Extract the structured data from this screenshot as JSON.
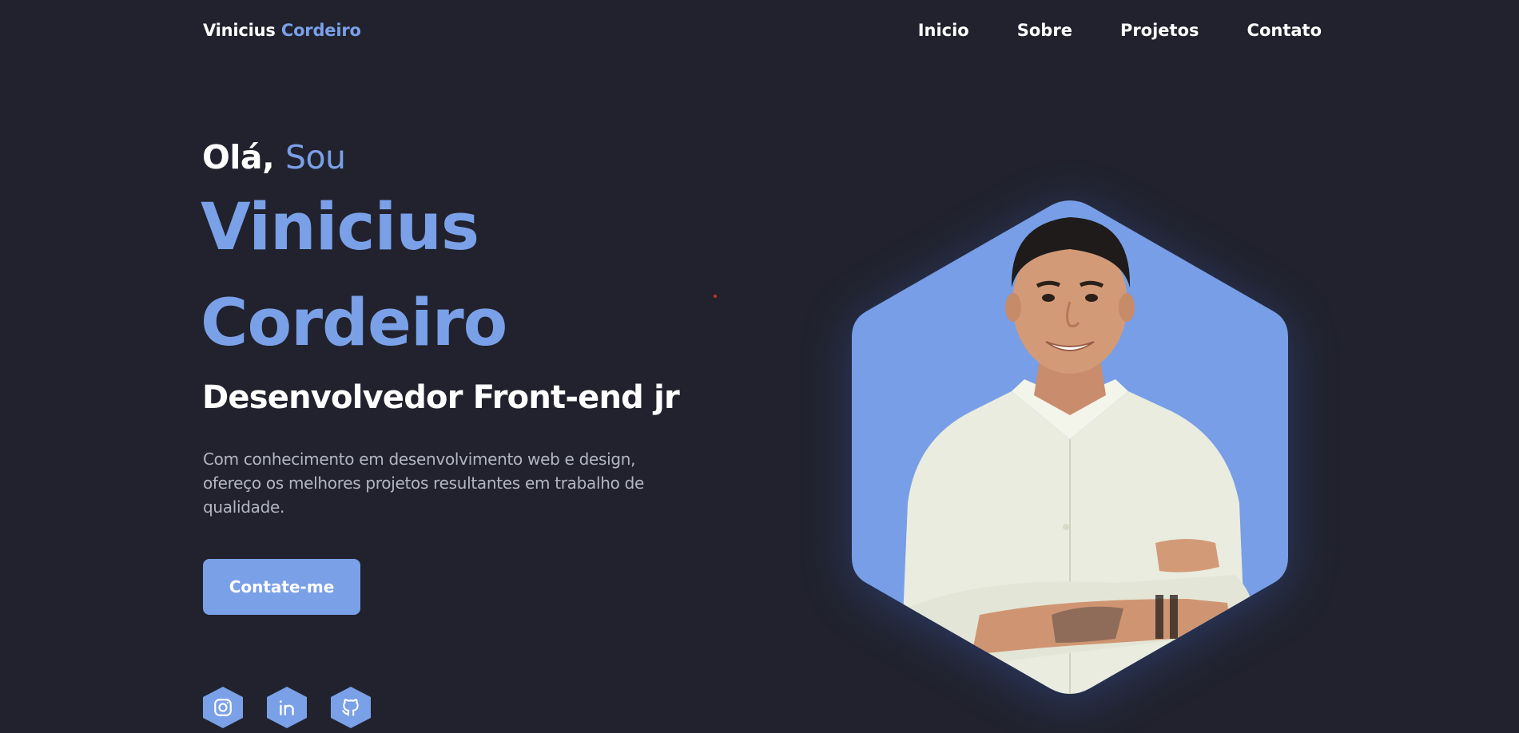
{
  "header": {
    "logo_first": "Vinicius",
    "logo_second": "Cordeiro",
    "nav": [
      "Inicio",
      "Sobre",
      "Projetos",
      "Contato"
    ]
  },
  "hero": {
    "greeting_prefix": "Olá,",
    "greeting_accent": "Sou",
    "first_name": "Vinicius",
    "last_name": "Cordeiro",
    "role": "Desenvolvedor Front-end jr",
    "description": "Com conhecimento em desenvolvimento web e design, ofereço os melhores projetos resultantes em trabalho de qualidade.",
    "cta_label": "Contate-me"
  },
  "social": [
    {
      "icon": "instagram-icon"
    },
    {
      "icon": "linkedin-icon"
    },
    {
      "icon": "github-icon"
    }
  ],
  "theme": {
    "background": "#21222d",
    "accent": "#7aa0e8",
    "text": "#ffffff",
    "muted_text": "#b4b6c1"
  }
}
